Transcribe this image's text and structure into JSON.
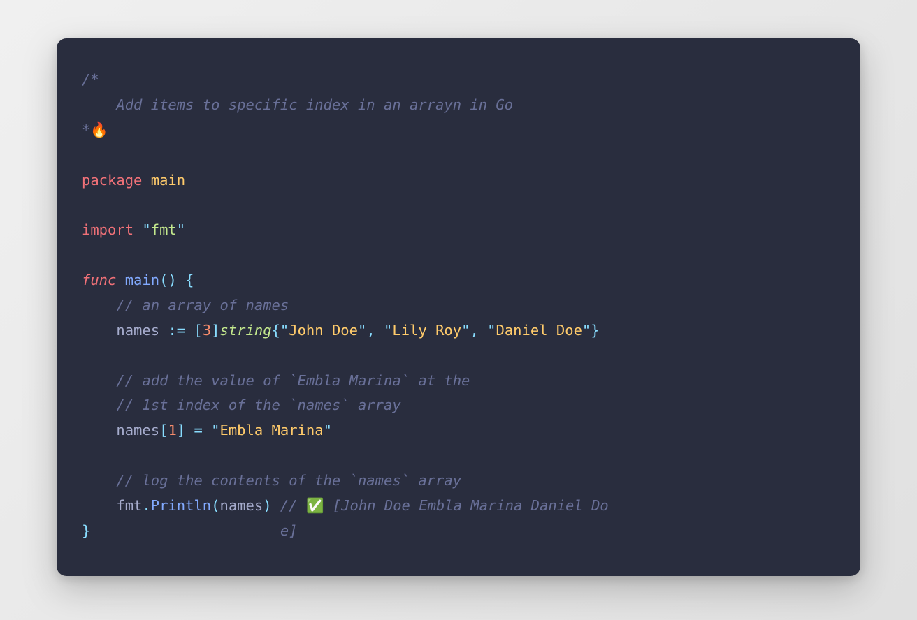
{
  "code": {
    "comment_block": {
      "open": "/*",
      "line": "    Add items to specific index in an arrayn in Go",
      "close_prefix": "*",
      "emoji": "🔥"
    },
    "pkg_kw": "package",
    "pkg_name": "main",
    "import_kw": "import",
    "import_val": "fmt",
    "func_kw": "func",
    "func_name": "main",
    "paren_open": "(",
    "paren_close": ")",
    "brace_open": "{",
    "brace_close": "}",
    "comment_arr": "// an array of names",
    "names_ident": "names",
    "walrus": ":=",
    "bracket_open": "[",
    "three": "3",
    "bracket_close": "]",
    "string_type": "string",
    "str1": "John Doe",
    "str2": "Lily Roy",
    "str3": "Daniel Doe",
    "comma": ",",
    "comment_add1": "// add the value of `Embla Marina` at the",
    "comment_add2": "// 1st index of the `names` array",
    "one": "1",
    "eq": "=",
    "str4": "Embla Marina",
    "comment_log": "// log the contents of the `names` array",
    "fmt": "fmt",
    "dot": ".",
    "println": "Println",
    "comment_result_prefix": "// ",
    "result_emoji": "✅",
    "comment_result_body": " [John Doe Embla Marina Daniel Do",
    "comment_result_wrap": "e]",
    "quote": "\""
  }
}
